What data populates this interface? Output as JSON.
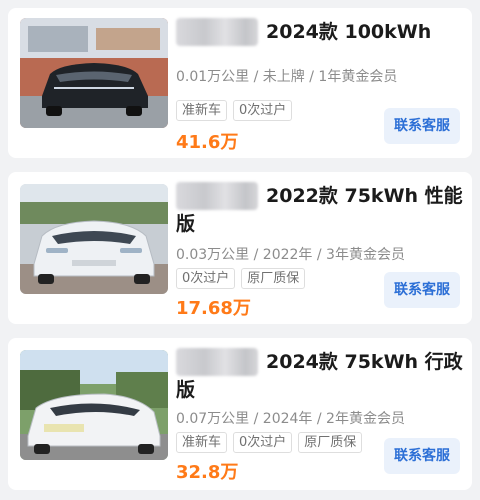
{
  "listings": [
    {
      "title": "2024款 100kWh",
      "meta": "0.01万公里 / 未上牌 / 1年黄金会员",
      "tags": [
        "准新车",
        "0次过户"
      ],
      "price": "41.6万",
      "contact_label": "联系客服",
      "car_color": "#1f2328"
    },
    {
      "title": "2022款 75kWh 性能版",
      "meta": "0.03万公里 / 2022年 / 3年黄金会员",
      "tags": [
        "0次过户",
        "原厂质保"
      ],
      "price": "17.68万",
      "contact_label": "联系客服",
      "car_color": "#e9edf1"
    },
    {
      "title": "2024款 75kWh 行政版",
      "meta": "0.07万公里 / 2024年 / 2年黄金会员",
      "tags": [
        "准新车",
        "0次过户",
        "原厂质保"
      ],
      "price": "32.8万",
      "contact_label": "联系客服",
      "car_color": "#f2f3f5"
    }
  ],
  "colors": {
    "price": "#ff7a18",
    "button_bg": "#eaf1fb",
    "button_text": "#2c6fd6"
  }
}
